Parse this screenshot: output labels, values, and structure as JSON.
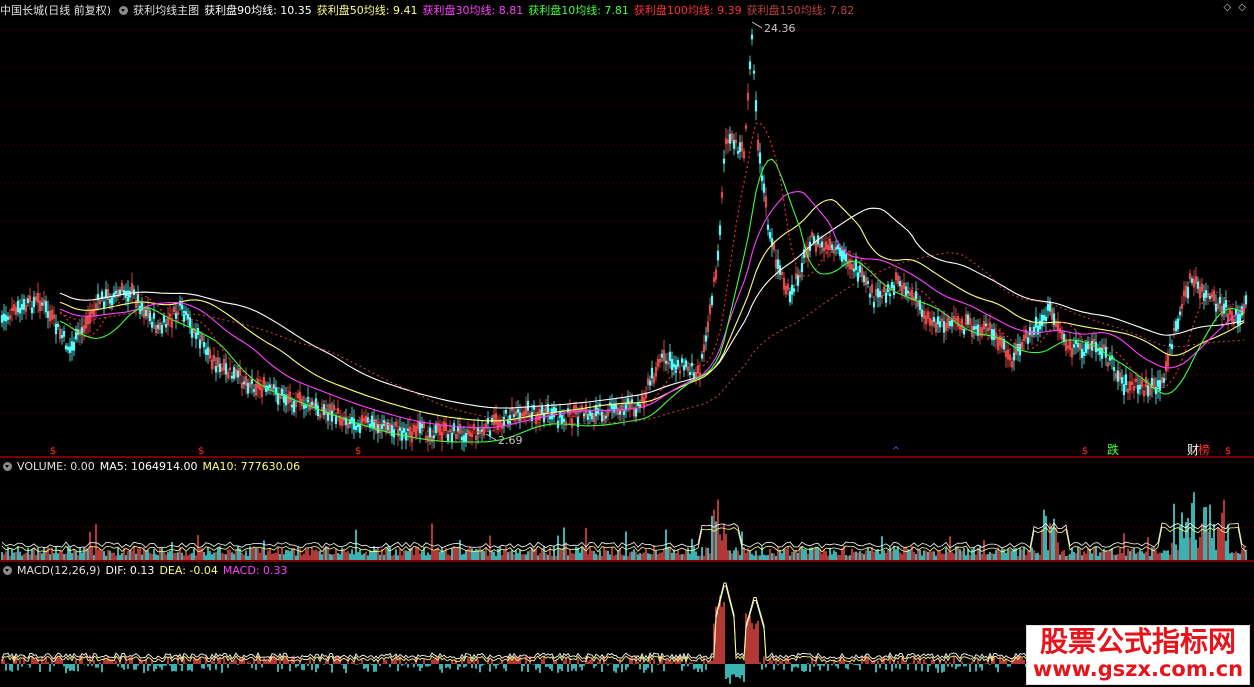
{
  "main_header": {
    "stock": "中国长城(日线 前复权)",
    "indicator": "获利均线主图",
    "lines": [
      {
        "label": "获利盘90均线: 10.35",
        "color": "#ffffff"
      },
      {
        "label": "获利盘50均线: 9.41",
        "color": "#ffff80"
      },
      {
        "label": "获利盘30均线: 8.81",
        "color": "#ff40ff"
      },
      {
        "label": "获利盘10均线: 7.81",
        "color": "#40ff40"
      },
      {
        "label": "获利盘100均线: 9.39",
        "color": "#ff3030"
      },
      {
        "label": "获利盘150均线: 7.82",
        "color": "#c04040"
      }
    ],
    "controls": "◇ ◇"
  },
  "volume_header": {
    "name": "VOLUME: 0.00",
    "ma5": "MA5: 1064914.00",
    "ma10": "MA10: 777630.06"
  },
  "macd_header": {
    "name": "MACD(12,26,9)",
    "dif": "DIF: 0.13",
    "dea": "DEA: -0.04",
    "macd": "MACD: 0.33"
  },
  "chart_data": {
    "type": "line",
    "price_high_label": "24.36",
    "price_low_label": "2.69",
    "markers": [
      {
        "text": "$",
        "color": "#ff3030"
      },
      {
        "text": "$",
        "color": "#ff3030"
      },
      {
        "text": "$",
        "color": "#ff3030"
      },
      {
        "text": "^",
        "color": "#6060ff"
      },
      {
        "text": "$",
        "color": "#ff3030"
      },
      {
        "text": "跌",
        "color": "#40ff40"
      },
      {
        "text": "财",
        "color": "#ffffff"
      },
      {
        "text": "榜",
        "color": "#ff3030"
      },
      {
        "text": "$",
        "color": "#ff3030"
      }
    ]
  },
  "watermark": {
    "title": "股票公式指标网",
    "url": "www.gszx.com.cn"
  },
  "colors": {
    "grid": "#5a0000",
    "up": "#ff5050",
    "down": "#54ffff",
    "border": "#a00000"
  }
}
